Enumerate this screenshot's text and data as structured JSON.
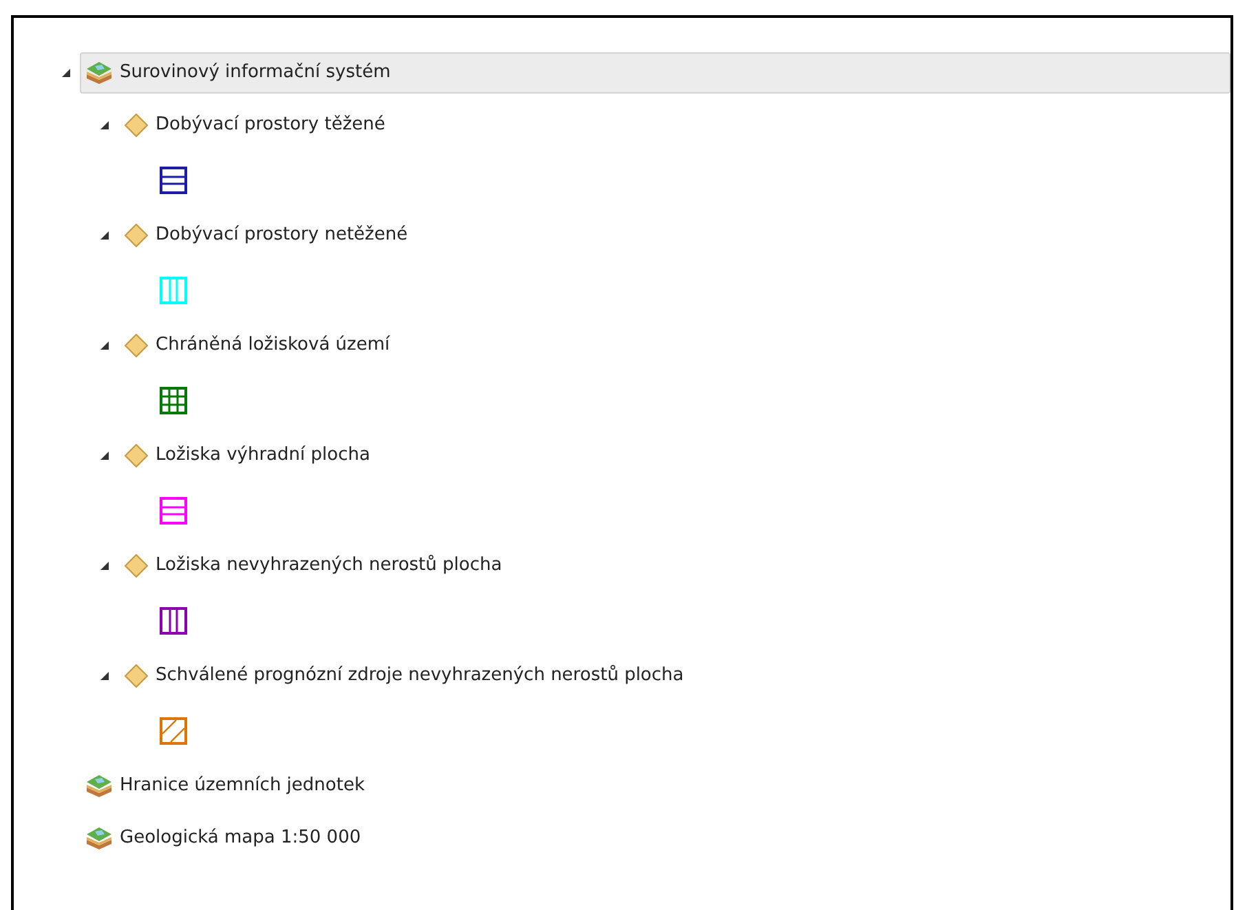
{
  "tree": [
    {
      "label": "Surovinový informační systém",
      "kind": "service",
      "expanded": true,
      "selected": true,
      "children": [
        {
          "label": "Dobývací prostory těžené",
          "kind": "layer",
          "expanded": true,
          "selected": false,
          "legend": {
            "kind": "horizontal",
            "color": "#1c1ca8"
          }
        },
        {
          "label": "Dobývací prostory netěžené",
          "kind": "layer",
          "expanded": true,
          "selected": false,
          "legend": {
            "kind": "vertical",
            "color": "#00ffff"
          }
        },
        {
          "label": "Chráněná ložisková území",
          "kind": "layer",
          "expanded": true,
          "selected": false,
          "legend": {
            "kind": "grid",
            "color": "#007a00"
          }
        },
        {
          "label": "Ložiska výhradní plocha",
          "kind": "layer",
          "expanded": true,
          "selected": false,
          "legend": {
            "kind": "horizontal",
            "color": "#ff00ff"
          }
        },
        {
          "label": "Ložiska nevyhrazených nerostů plocha",
          "kind": "layer",
          "expanded": true,
          "selected": false,
          "legend": {
            "kind": "vertical",
            "color": "#8a00b0"
          }
        },
        {
          "label": "Schválené prognózní zdroje nevyhrazených nerostů plocha",
          "kind": "layer",
          "expanded": true,
          "selected": false,
          "legend": {
            "kind": "hatch",
            "color": "#e07400"
          }
        }
      ]
    },
    {
      "label": "Hranice územních jednotek",
      "kind": "service",
      "selected": false
    },
    {
      "label": "Geologická mapa 1:50 000",
      "kind": "service",
      "selected": false
    }
  ]
}
